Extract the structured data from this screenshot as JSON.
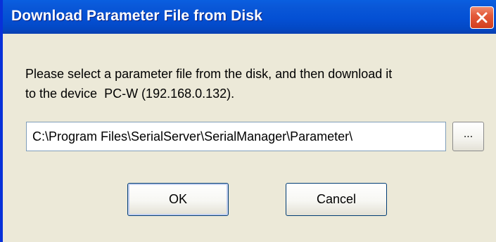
{
  "window": {
    "title": "Download Parameter File from Disk",
    "close_icon": "close-icon",
    "colors": {
      "titlebar": "#0450d4",
      "close_button": "#e35a3a",
      "body": "#ece9d8"
    }
  },
  "message": {
    "line1": "Please select a parameter file from the disk, and then download it",
    "line2": "to the device  PC-W (192.168.0.132)."
  },
  "path_field": {
    "value": "C:\\Program Files\\SerialServer\\SerialManager\\Parameter\\"
  },
  "browse_button": {
    "label": "..."
  },
  "buttons": {
    "ok_label": "OK",
    "cancel_label": "Cancel"
  }
}
